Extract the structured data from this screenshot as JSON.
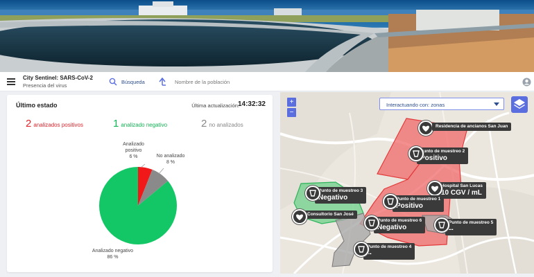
{
  "header": {
    "app_title": "City Sentinel: SARS-CoV-2",
    "app_subtitle": "Presencia del virus",
    "search_label": "Búsqueda",
    "population_placeholder": "Nombre de la población"
  },
  "status": {
    "title": "Último estado",
    "update_label": "Última actualización:",
    "update_time": "14:32:32",
    "positive_count": "2",
    "positive_label": "analizados positivos",
    "negative_count": "1",
    "negative_label": "analizado negativo",
    "none_count": "2",
    "none_label": "no analizados"
  },
  "chart_data": {
    "type": "pie",
    "slices": [
      {
        "name": "Analizado negativo",
        "value": 86,
        "label": "86 %",
        "color": "#14c766"
      },
      {
        "name": "Analizado positivo",
        "value": 6,
        "label": "6 %",
        "color": "#f01818"
      },
      {
        "name": "No analizado",
        "value": 8,
        "label": "8 %",
        "color": "#8a8a8a"
      }
    ]
  },
  "map": {
    "zoom_in": "+",
    "zoom_out": "−",
    "layer_select_value": "Interactuando con: zonas",
    "zone_colors": {
      "positive": "#f06a6a",
      "negative": "#6fd08a",
      "none": "#a9a9a9"
    },
    "markers": [
      {
        "key": "residencia",
        "line1": "Residencia de ancianos San Juan",
        "line2": ""
      },
      {
        "key": "punto2",
        "line1": "Punto de muestreo 2",
        "line2": "Positivo"
      },
      {
        "key": "hospital",
        "line1": "Hospital San Lucas",
        "line2": "10 CGV / mL"
      },
      {
        "key": "punto3",
        "line1": "Punto de muestreo 3",
        "line2": "Negativo"
      },
      {
        "key": "punto1",
        "line1": "Punto de muestreo 1",
        "line2": "Positivo"
      },
      {
        "key": "consultorio",
        "line1": "Consultorio San José",
        "line2": ""
      },
      {
        "key": "punto6",
        "line1": "Punto de muestreo 6",
        "line2": "Negativo"
      },
      {
        "key": "punto5",
        "line1": "Punto de muestreo 5",
        "line2": "--"
      },
      {
        "key": "punto4",
        "line1": "Punto de muestreo 4",
        "line2": "--"
      }
    ]
  }
}
